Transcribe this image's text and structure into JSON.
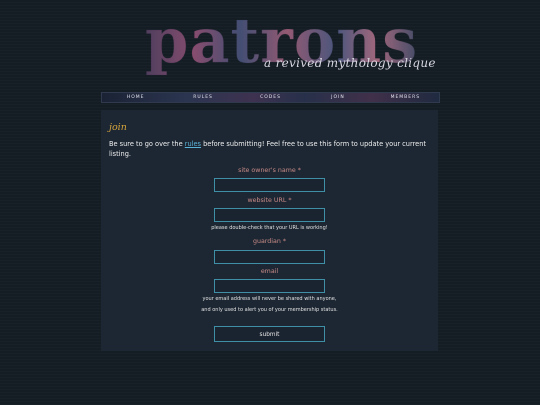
{
  "site": {
    "title": "patrons",
    "tagline": "a revived mythology clique"
  },
  "nav": {
    "items": [
      "home",
      "rules",
      "codes",
      "join",
      "members"
    ]
  },
  "form": {
    "heading": "join",
    "intro_before": "Be sure to go over the ",
    "intro_link": "rules",
    "intro_after": " before submitting! Feel free to use this form to update your current listing.",
    "fields": {
      "owner_name": {
        "label": "site owner's name",
        "required_mark": "*",
        "value": ""
      },
      "website_url": {
        "label": "website URL",
        "required_mark": "*",
        "value": "",
        "hint": "please double-check that your URL is working!"
      },
      "guardian": {
        "label": "guardian",
        "required_mark": "*",
        "value": ""
      },
      "email": {
        "label": "email",
        "value": "",
        "hint_line1": "your email address will never be shared with anyone,",
        "hint_line2": "and only used to alert you of your membership status."
      }
    },
    "submit_label": "submit"
  },
  "colors": {
    "background": "#141c24",
    "panel": "#1d2733",
    "heading_gold": "#d4a33c",
    "label_rose": "#c78a86",
    "link_blue": "#5ab3d8",
    "input_border": "#3f8fa6"
  }
}
